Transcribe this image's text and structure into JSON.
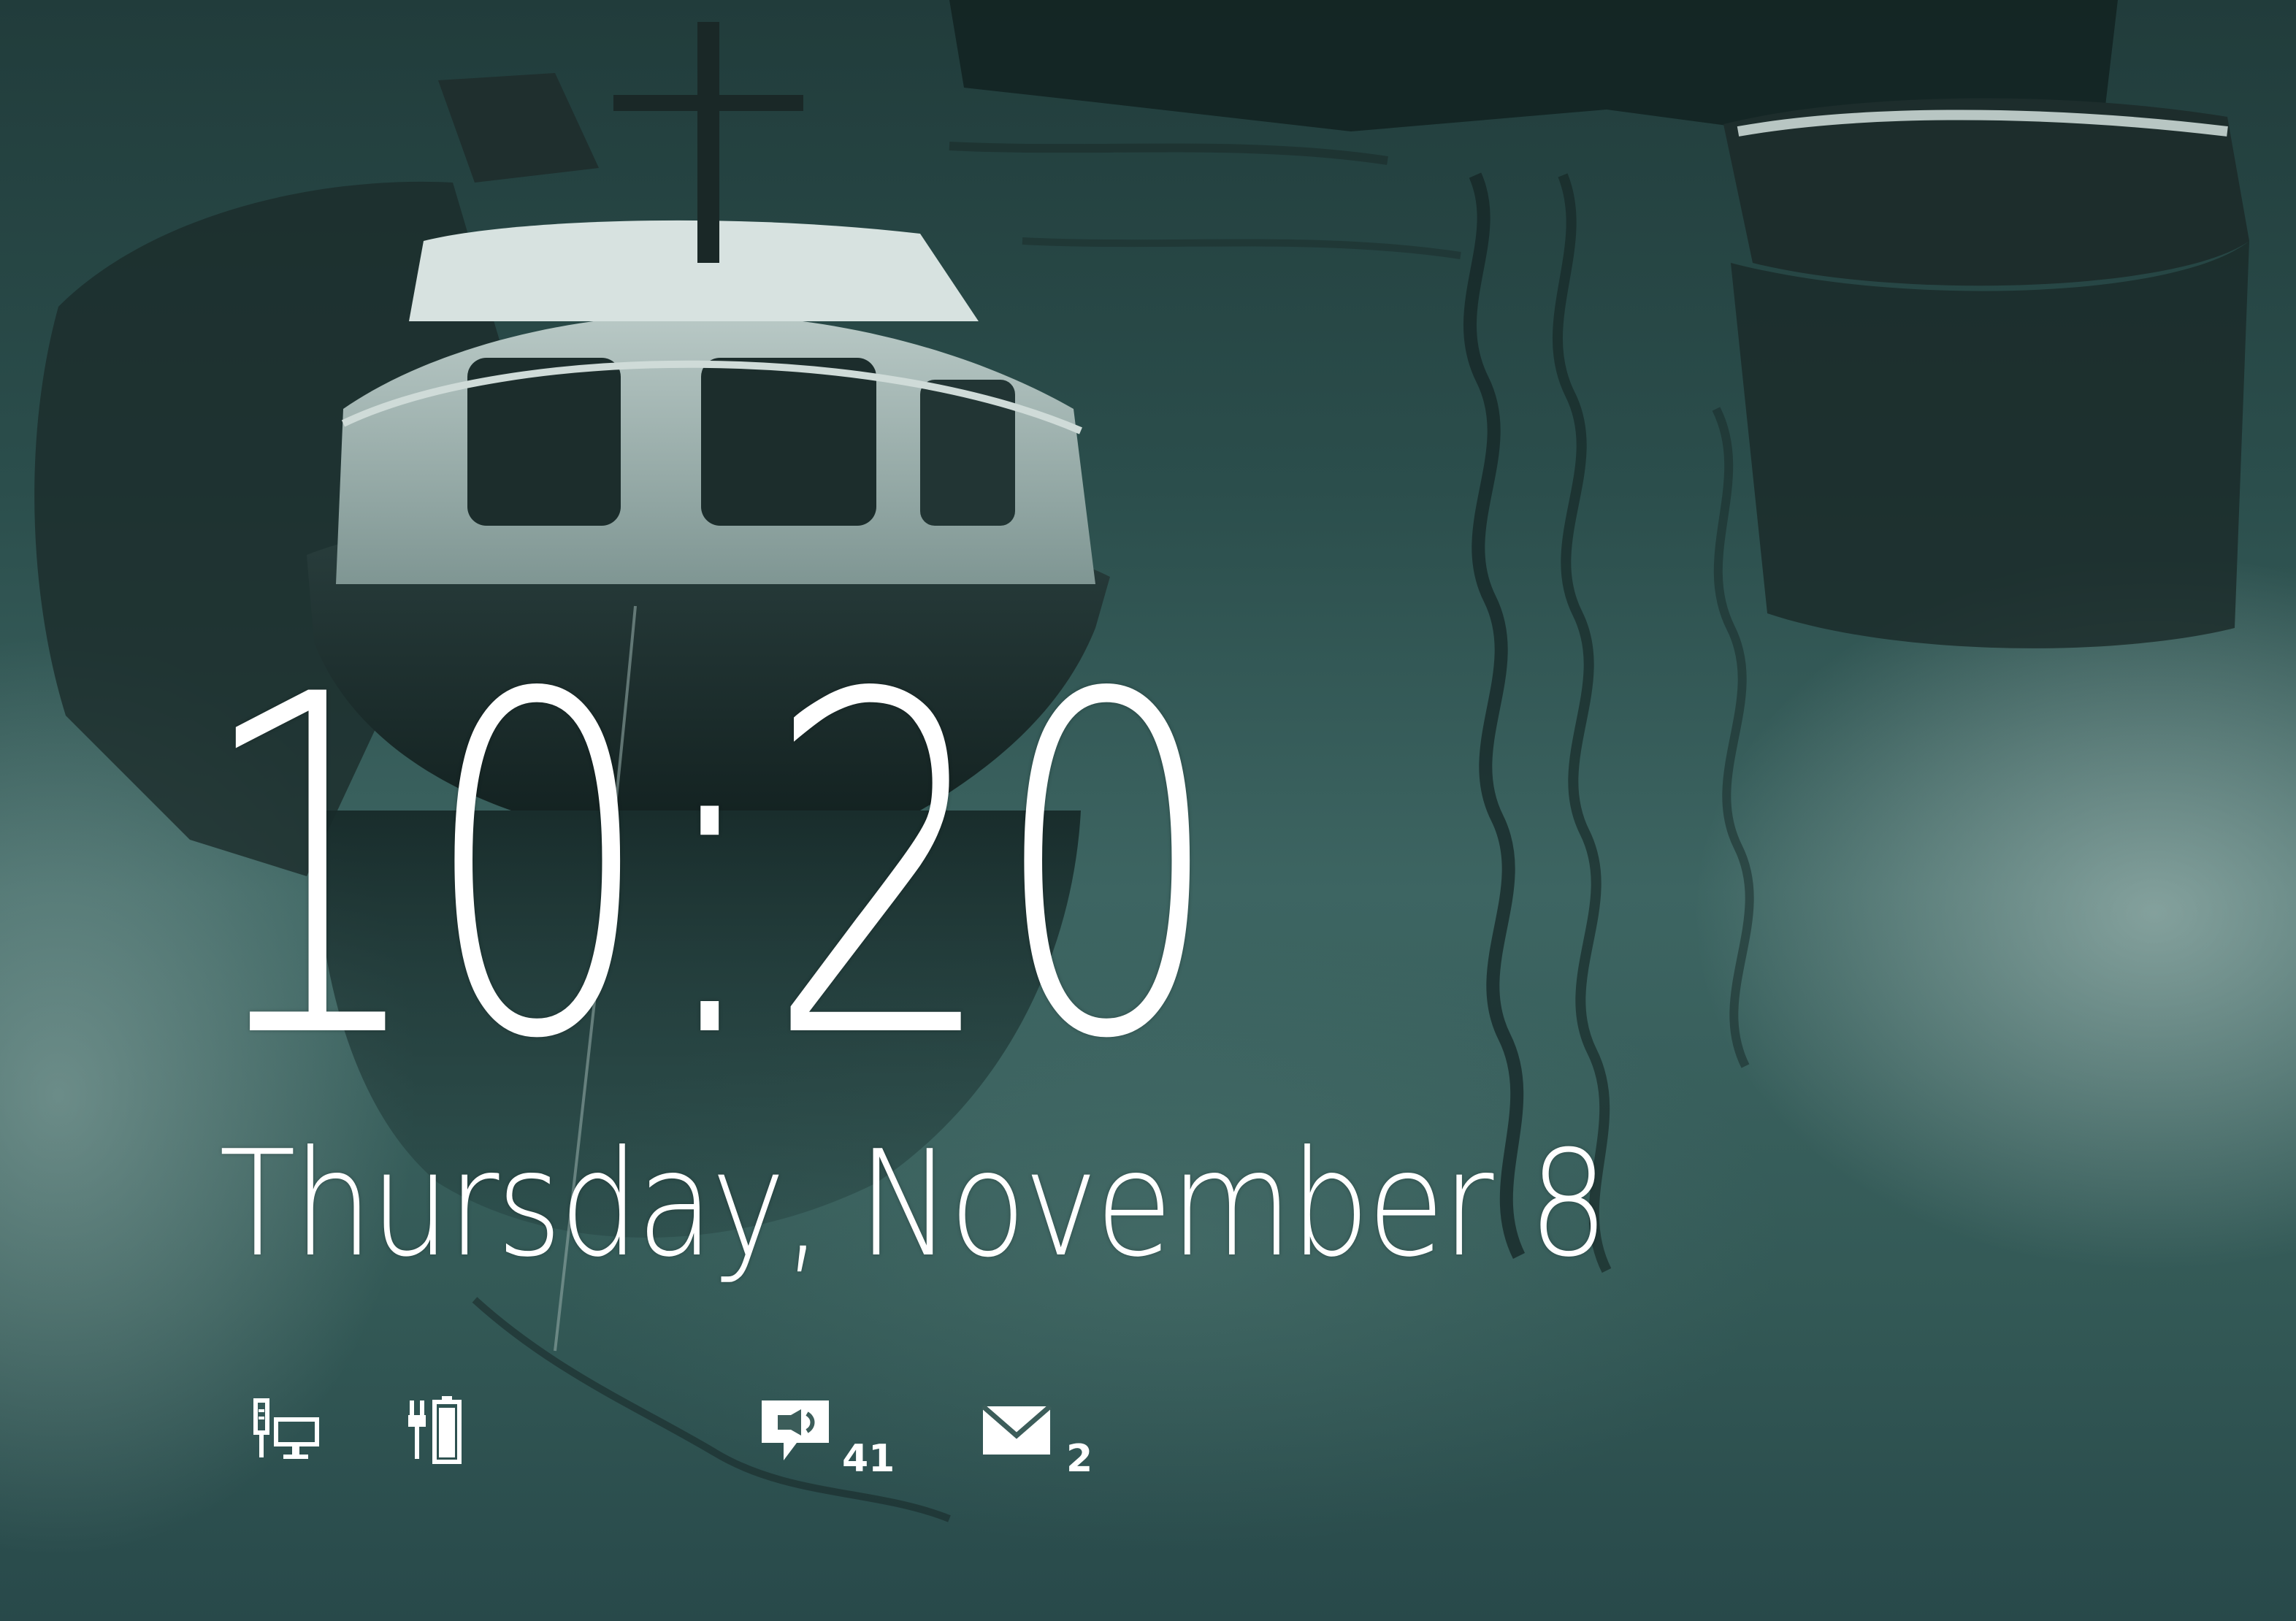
{
  "lock_screen": {
    "time": "10:20",
    "date": "Thursday, November 8"
  },
  "status": {
    "network_icon": "ethernet-network-icon",
    "battery_icon": "battery-charging-icon",
    "messages": {
      "icon": "message-bubble-icon",
      "count": "41"
    },
    "mail": {
      "icon": "mail-envelope-icon",
      "count": "2"
    }
  },
  "colors": {
    "text": "#ffffff",
    "wallpaper_tone": "#3d6562"
  }
}
